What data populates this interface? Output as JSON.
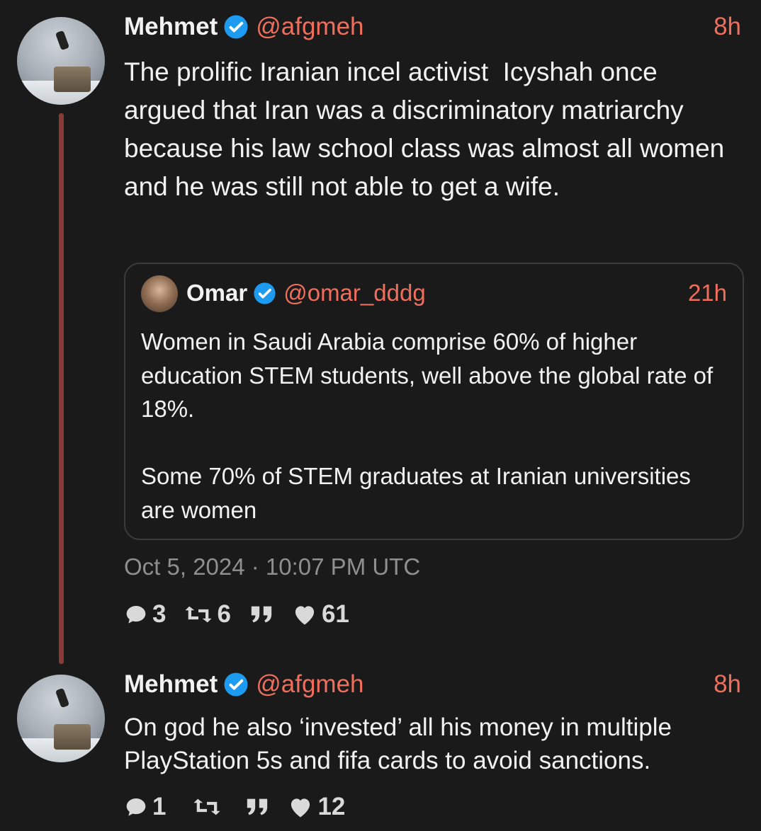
{
  "tweet1": {
    "name": "Mehmet",
    "handle": "@afgmeh",
    "time": "8h",
    "text": "The prolific Iranian incel activist  Icyshah once argued that Iran was a discriminatory matriarchy because his law school class was almost all women and he was still not able to get a wife.",
    "quote": {
      "name": "Omar",
      "handle": "@omar_dddg",
      "time": "21h",
      "text": "Women in Saudi Arabia comprise 60% of higher education STEM students, well above the global rate of 18%.\n\nSome 70% of STEM graduates at Iranian universities are women"
    },
    "timestamp": "Oct 5, 2024 · 10:07 PM UTC",
    "replies": "3",
    "retweets": "6",
    "likes": "61"
  },
  "tweet2": {
    "name": "Mehmet",
    "handle": "@afgmeh",
    "time": "8h",
    "text": "On god he also ‘invested’ all his money in multiple PlayStation 5s and fifa cards to avoid sanctions.",
    "replies": "1",
    "likes": "12"
  },
  "colors": {
    "background": "#1a1a1a",
    "accent": "#ef6e5c",
    "verified": "#1d9bf0",
    "thread_line": "#8a3a37"
  },
  "icons": [
    "verified-badge-icon",
    "reply-icon",
    "retweet-icon",
    "quote-icon",
    "heart-icon"
  ]
}
